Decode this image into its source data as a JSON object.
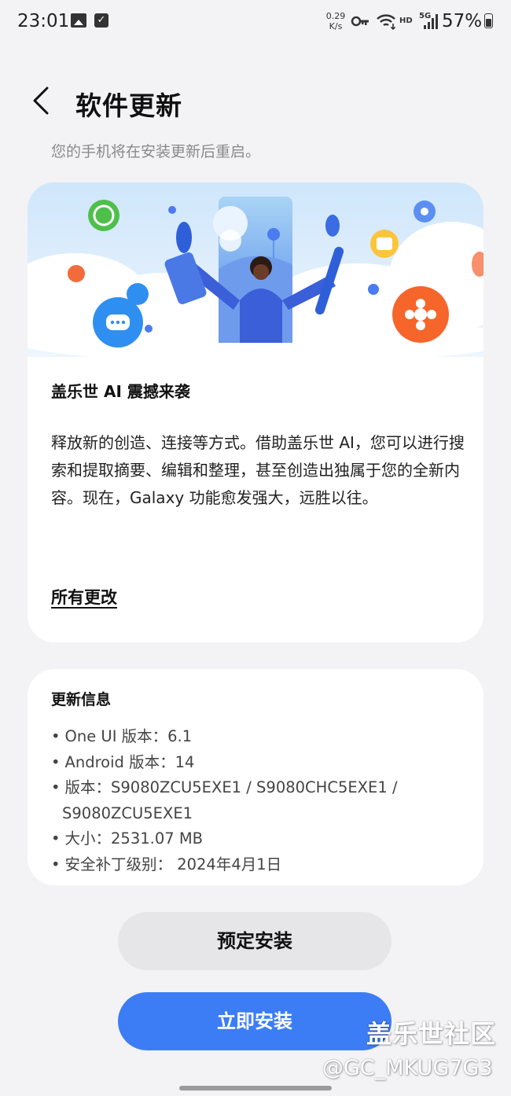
{
  "status_bar": {
    "time": "23:01",
    "speed_value": "0.29",
    "speed_unit": "K/s",
    "network_label": "HD",
    "signal_label": "5G",
    "battery": "57%",
    "icons": [
      "image-icon",
      "check-icon",
      "key-icon",
      "wifi-icon",
      "signal-icon",
      "battery-icon"
    ]
  },
  "header": {
    "title": "软件更新",
    "subtitle": "您的手机将在安装更新后重启。"
  },
  "hero": {
    "title": "盖乐世 AI 震撼来袭",
    "description": "释放新的创造、连接等方式。借助盖乐世 AI，您可以进行搜索和提取摘要、编辑和整理，甚至创造出独属于您的全新内容。现在，Galaxy 功能愈发强大，远胜以往。",
    "all_changes": "所有更改"
  },
  "update_info": {
    "title": "更新信息",
    "items": [
      "One UI 版本：6.1",
      "Android 版本：14",
      "版本：S9080ZCU5EXE1 / S9080CHC5EXE1 / S9080ZCU5EXE1",
      "大小：2531.07 MB",
      "安全补丁级别： 2024年4月1日"
    ]
  },
  "buttons": {
    "schedule": "预定安装",
    "install_now": "立即安装"
  },
  "watermark": {
    "title": "盖乐世社区",
    "handle": "@GC_MKUG7G3"
  },
  "colors": {
    "accent": "#3c7df6",
    "background": "#f3f3f6",
    "card": "#ffffff",
    "secondary_button": "#e6e6e9"
  }
}
